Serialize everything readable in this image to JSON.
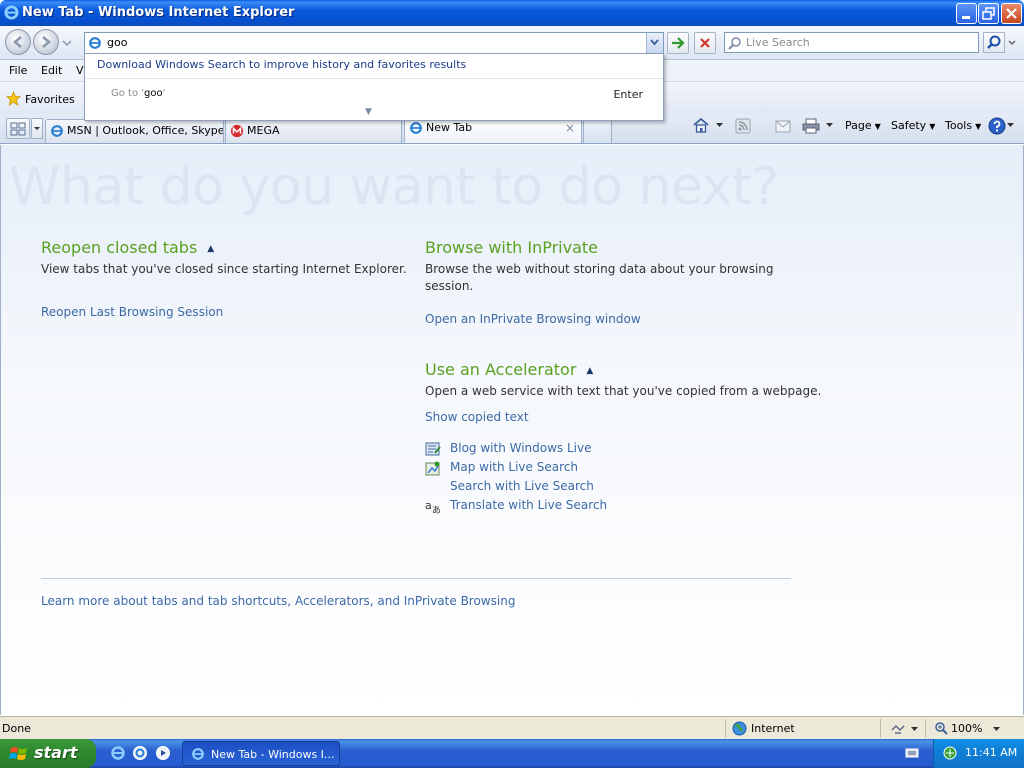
{
  "window": {
    "title": "New Tab - Windows Internet Explorer"
  },
  "address_bar": {
    "value": "goo"
  },
  "search": {
    "placeholder": "Live Search"
  },
  "menu": {
    "items": [
      "File",
      "Edit",
      "Vi"
    ]
  },
  "favorites": {
    "label": "Favorites"
  },
  "tabs": [
    {
      "label": "MSN | Outlook, Office, Skype...",
      "icon": "ie-icon"
    },
    {
      "label": "MEGA",
      "icon": "mega-icon"
    },
    {
      "label": "New Tab",
      "icon": "ie-icon",
      "close": "×"
    }
  ],
  "commands": {
    "page": "Page",
    "safety": "Safety",
    "tools": "Tools"
  },
  "autocomplete": {
    "banner": "Download Windows Search to improve history and favorites results",
    "goto_prefix": "Go to '",
    "goto_query": "goo",
    "goto_suffix": "'",
    "enter_label": "Enter"
  },
  "content": {
    "hero": "What do you want to do next?",
    "reopen": {
      "title": "Reopen closed tabs",
      "desc": "View tabs that you've closed since starting Internet Explorer.",
      "link": "Reopen Last Browsing Session"
    },
    "inprivate": {
      "title": "Browse with InPrivate",
      "desc": "Browse the web without storing data about your browsing session.",
      "link": "Open an InPrivate Browsing window"
    },
    "accelerator": {
      "title": "Use an Accelerator",
      "desc": "Open a web service with text that you've copied from a webpage.",
      "show_link": "Show copied text",
      "items": [
        {
          "label": "Blog with Windows Live",
          "icon": "blog-icon"
        },
        {
          "label": "Map with Live Search",
          "icon": "map-icon"
        },
        {
          "label": "Search with Live Search",
          "icon": ""
        },
        {
          "label": "Translate with Live Search",
          "icon": "translate-icon"
        }
      ]
    },
    "learn_more": "Learn more about tabs and tab shortcuts, Accelerators, and InPrivate Browsing"
  },
  "status": {
    "text": "Done",
    "zone": "Internet",
    "zoom": "100%"
  },
  "taskbar": {
    "start_label": "start",
    "task_label": "New Tab - Windows I...",
    "clock": "11:41 AM"
  },
  "colors": {
    "title_blue": "#0a5bdc",
    "section_green": "#5aa021",
    "link_blue": "#3d6aa6",
    "start_green": "#2f8a2f"
  }
}
